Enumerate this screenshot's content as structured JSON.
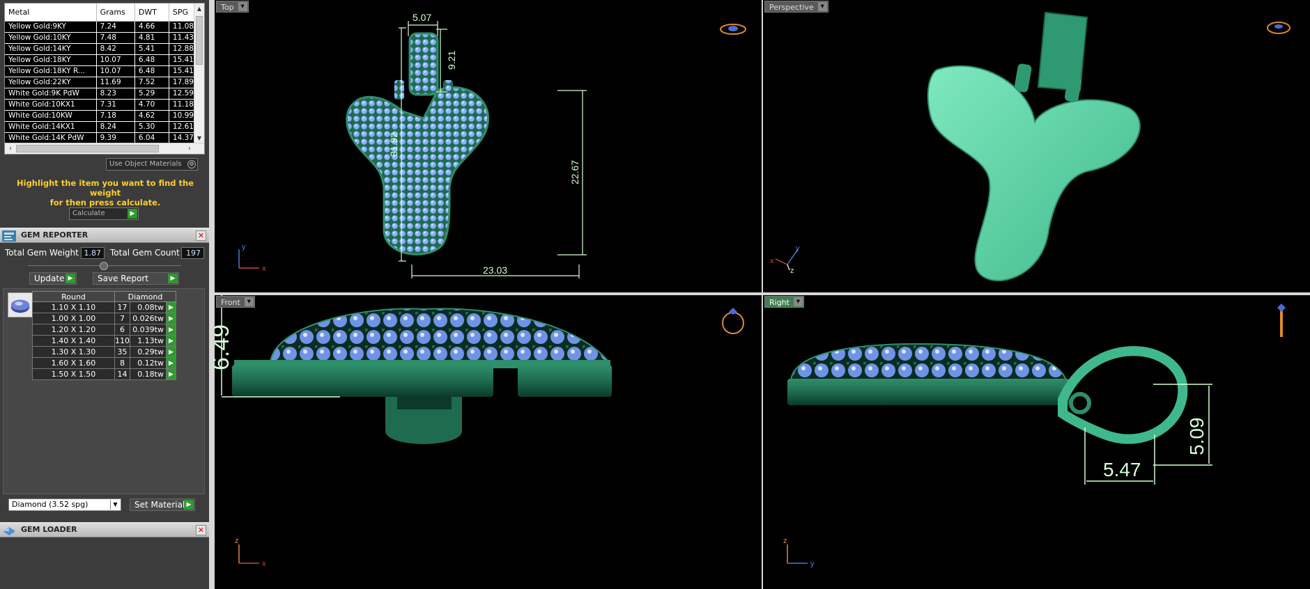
{
  "metal_table": {
    "headers": [
      "Metal",
      "Grams",
      "DWT",
      "SPG"
    ],
    "rows": [
      [
        "Yellow Gold:9KY",
        "7.24",
        "4.66",
        "11.08"
      ],
      [
        "Yellow Gold:10KY",
        "7.48",
        "4.81",
        "11.43"
      ],
      [
        "Yellow Gold:14KY",
        "8.42",
        "5.41",
        "12.88"
      ],
      [
        "Yellow Gold:18KY",
        "10.07",
        "6.48",
        "15.41"
      ],
      [
        "Yellow Gold:18KY R...",
        "10.07",
        "6.48",
        "15.41"
      ],
      [
        "Yellow Gold:22KY",
        "11.69",
        "7.52",
        "17.89"
      ],
      [
        "White Gold:9K PdW",
        "8.23",
        "5.29",
        "12.59"
      ],
      [
        "White Gold:10KX1",
        "7.31",
        "4.70",
        "11.18"
      ],
      [
        "White Gold:10KW",
        "7.18",
        "4.62",
        "10.99"
      ],
      [
        "White Gold:14KX1",
        "8.24",
        "5.30",
        "12.61"
      ],
      [
        "White Gold:14K PdW",
        "9.39",
        "6.04",
        "14.37"
      ]
    ]
  },
  "use_object_materials": "Use Object Materials",
  "highlight_message_1": "Highlight the item you want to find the weight",
  "highlight_message_2": "for then press calculate.",
  "calculate_label": "Calculate",
  "gem_reporter": {
    "title": "GEM REPORTER",
    "total_weight_label": "Total Gem Weight",
    "total_weight_value": "1.87",
    "total_count_label": "Total Gem Count",
    "total_count_value": "197",
    "update_label": "Update",
    "save_report_label": "Save Report",
    "gem_table": {
      "headers": [
        "Round",
        "Diamond"
      ],
      "rows": [
        [
          "1.10 X 1.10",
          "17",
          "0.08tw"
        ],
        [
          "1.00 X 1.00",
          "7",
          "0.026tw"
        ],
        [
          "1.20 X 1.20",
          "6",
          "0.039tw"
        ],
        [
          "1.40 X 1.40",
          "110",
          "1.13tw"
        ],
        [
          "1.30 X 1.30",
          "35",
          "0.29tw"
        ],
        [
          "1.60 X 1.60",
          "8",
          "0.12tw"
        ],
        [
          "1.50 X 1.50",
          "14",
          "0.18tw"
        ]
      ]
    },
    "material_select_value": "Diamond    (3.52 spg)",
    "set_material_label": "Set Material"
  },
  "gem_loader": {
    "title": "GEM LOADER"
  },
  "viewports": {
    "top": {
      "label": "Top",
      "dims": [
        "5.07",
        "9.21",
        "31.92",
        "22.67",
        "23.03"
      ],
      "axis_x": "x",
      "axis_y": "y"
    },
    "perspective": {
      "label": "Perspective",
      "axis_x": "x",
      "axis_y": "y",
      "axis_z": "z"
    },
    "front": {
      "label": "Front",
      "dims": [
        "6.49"
      ],
      "axis_x": "x",
      "axis_z": "z"
    },
    "right": {
      "label": "Right",
      "dims": [
        "5.09",
        "5.47"
      ],
      "axis_y": "y",
      "axis_z": "z"
    }
  },
  "colors": {
    "metal_green": "#2f8f6b",
    "pendant_light": "#58d6a8",
    "gem_blue": "#8ab0ff",
    "dim_line": "#d6ffd6",
    "highlight_text": "#ffd024"
  }
}
